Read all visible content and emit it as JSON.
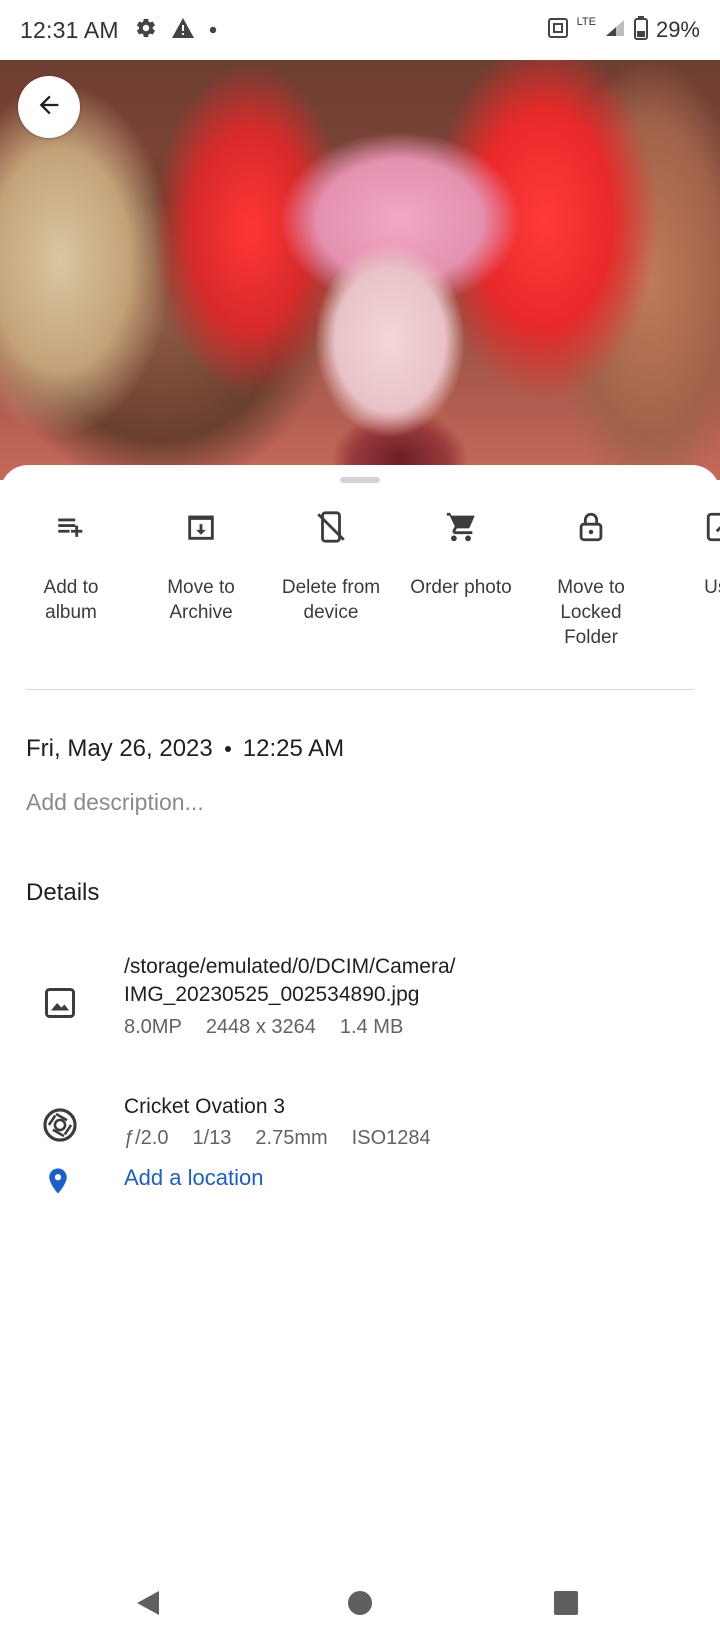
{
  "status_bar": {
    "time": "12:31 AM",
    "network_label": "LTE",
    "battery_percent": "29%",
    "icons": [
      "settings-gear-icon",
      "warning-icon",
      "notification-dot-icon",
      "nfc-icon",
      "lte-icon",
      "signal-icon",
      "battery-icon"
    ]
  },
  "photo": {
    "back_icon": "arrow-back-icon"
  },
  "actions": [
    {
      "label": "Add to\nalbum",
      "icon": "playlist-add-icon"
    },
    {
      "label": "Move to\nArchive",
      "icon": "archive-icon"
    },
    {
      "label": "Delete from\ndevice",
      "icon": "phone-off-icon"
    },
    {
      "label": "Order photo",
      "icon": "cart-icon"
    },
    {
      "label": "Move to\nLocked\nFolder",
      "icon": "lock-icon"
    },
    {
      "label": "Use",
      "icon": "edit-icon"
    }
  ],
  "info": {
    "date": "Fri, May 26, 2023",
    "time": "12:25 AM",
    "description_placeholder": "Add description..."
  },
  "details": {
    "heading": "Details",
    "file": {
      "path_line1": "/storage/emulated/0/DCIM/Camera/",
      "path_line2": "IMG_20230525_002534890.jpg",
      "megapixels": "8.0MP",
      "resolution": "2448 x 3264",
      "size": "1.4 MB",
      "icon": "image-icon"
    },
    "camera": {
      "model": "Cricket Ovation 3",
      "aperture": "ƒ/2.0",
      "shutter": "1/13",
      "focal_length": "2.75mm",
      "iso": "ISO1284",
      "icon": "aperture-icon"
    },
    "location": {
      "label": "Add a location",
      "icon": "location-pin-icon",
      "color": "#1a5fcc"
    }
  },
  "nav": {
    "icons": [
      "nav-back-icon",
      "nav-home-icon",
      "nav-recents-icon"
    ]
  }
}
